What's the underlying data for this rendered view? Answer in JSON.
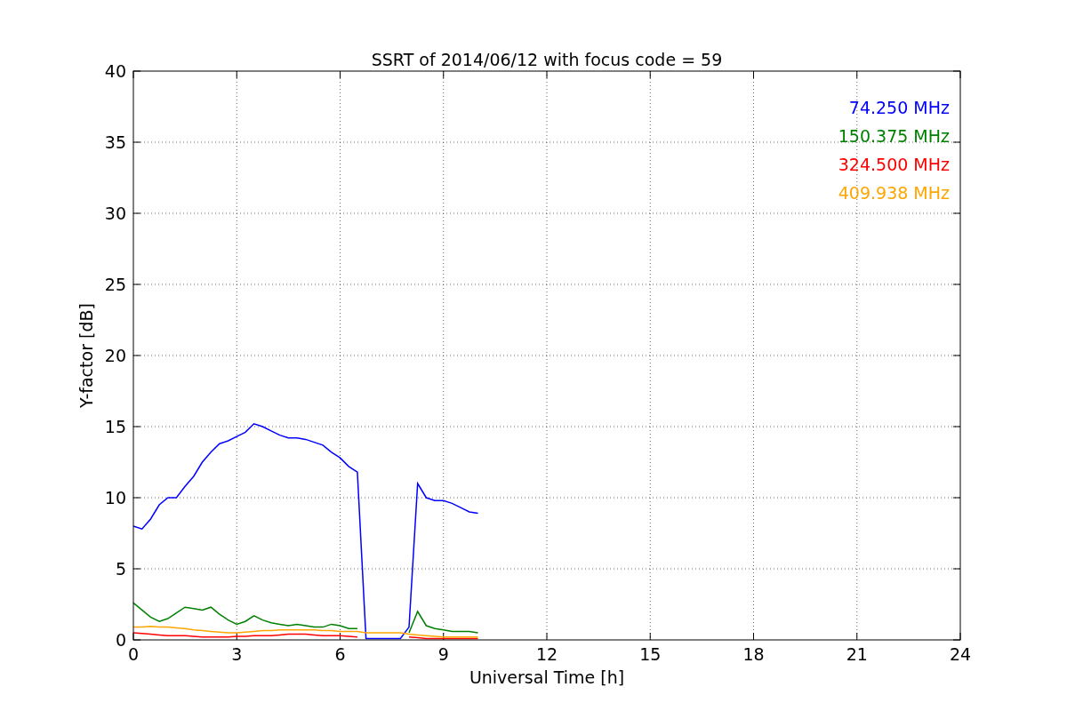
{
  "chart_data": {
    "type": "line",
    "title": "SSRT of 2014/06/12 with focus code = 59",
    "xlabel": "Universal Time [h]",
    "ylabel": "Y-factor [dB]",
    "x": [
      0,
      0.25,
      0.5,
      0.75,
      1,
      1.25,
      1.5,
      1.75,
      2,
      2.25,
      2.5,
      2.75,
      3,
      3.25,
      3.5,
      3.75,
      4,
      4.25,
      4.5,
      4.75,
      5,
      5.25,
      5.5,
      5.75,
      6,
      6.25,
      6.5,
      6.75,
      7,
      7.25,
      7.5,
      7.75,
      8,
      8.25,
      8.5,
      8.75,
      9,
      9.25,
      9.5,
      9.75,
      10
    ],
    "series": [
      {
        "name": "74.250 MHz",
        "color": "#0000ff",
        "values": [
          8.0,
          7.8,
          8.5,
          9.5,
          10.0,
          10.0,
          10.8,
          11.5,
          12.5,
          13.2,
          13.8,
          14.0,
          14.3,
          14.6,
          15.2,
          15.0,
          14.7,
          14.4,
          14.2,
          14.2,
          14.1,
          13.9,
          13.7,
          13.2,
          12.8,
          12.2,
          11.8,
          0.1,
          0.1,
          0.1,
          0.1,
          0.1,
          0.9,
          11.0,
          10.0,
          9.8,
          9.8,
          9.6,
          9.3,
          9.0,
          8.9
        ]
      },
      {
        "name": "150.375 MHz",
        "color": "#008000",
        "values": [
          2.6,
          2.1,
          1.6,
          1.3,
          1.5,
          1.9,
          2.3,
          2.2,
          2.1,
          2.3,
          1.8,
          1.4,
          1.1,
          1.3,
          1.7,
          1.4,
          1.2,
          1.1,
          1.0,
          1.1,
          1.0,
          0.9,
          0.9,
          1.1,
          1.0,
          0.8,
          0.8,
          null,
          null,
          null,
          null,
          null,
          0.5,
          2.0,
          1.0,
          0.8,
          0.7,
          0.6,
          0.6,
          0.6,
          0.5
        ]
      },
      {
        "name": "324.500 MHz",
        "color": "#ff0000",
        "values": [
          0.5,
          0.45,
          0.4,
          0.35,
          0.3,
          0.3,
          0.3,
          0.25,
          0.2,
          0.2,
          0.2,
          0.2,
          0.25,
          0.25,
          0.3,
          0.3,
          0.3,
          0.35,
          0.4,
          0.4,
          0.4,
          0.35,
          0.3,
          0.3,
          0.3,
          0.25,
          0.2,
          null,
          null,
          null,
          null,
          null,
          0.2,
          0.15,
          0.1,
          0.1,
          0.1,
          0.1,
          0.1,
          0.1,
          0.1
        ]
      },
      {
        "name": "409.938 MHz",
        "color": "#ffa500",
        "values": [
          0.9,
          0.9,
          0.95,
          0.9,
          0.9,
          0.85,
          0.8,
          0.7,
          0.65,
          0.6,
          0.55,
          0.5,
          0.5,
          0.55,
          0.6,
          0.65,
          0.65,
          0.7,
          0.7,
          0.7,
          0.7,
          0.7,
          0.65,
          0.65,
          0.6,
          0.6,
          0.6,
          0.5,
          0.5,
          0.5,
          0.5,
          0.5,
          0.4,
          0.35,
          0.3,
          0.25,
          0.2,
          0.2,
          0.2,
          0.2,
          0.2
        ]
      }
    ],
    "grid": true,
    "xlim": [
      0,
      24
    ],
    "ylim": [
      0,
      40
    ],
    "xticks": [
      0,
      3,
      6,
      9,
      12,
      15,
      18,
      21,
      24
    ],
    "yticks": [
      0,
      5,
      10,
      15,
      20,
      25,
      30,
      35,
      40
    ]
  }
}
